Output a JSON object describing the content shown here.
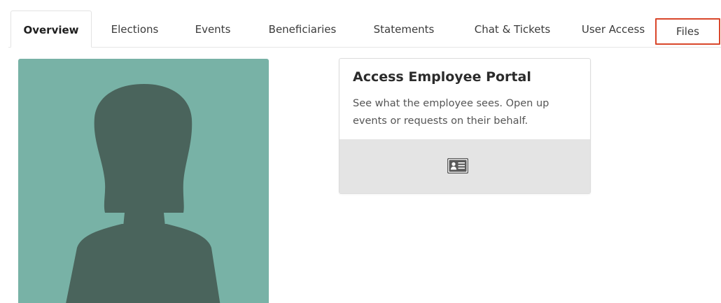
{
  "tabs": [
    {
      "label": "Overview",
      "active": true
    },
    {
      "label": "Elections"
    },
    {
      "label": "Events"
    },
    {
      "label": "Beneficiaries"
    },
    {
      "label": "Statements"
    },
    {
      "label": "Chat & Tickets"
    },
    {
      "label": "User Access"
    },
    {
      "label": "Files",
      "highlighted": true
    }
  ],
  "avatar": {
    "icon": "person-silhouette-icon",
    "background_color": "#78b2a6",
    "silhouette_color": "#4a645c"
  },
  "portal_card": {
    "title": "Access Employee Portal",
    "description": "See what the employee sees. Open up events or requests on their behalf.",
    "action_icon": "id-card-icon"
  },
  "colors": {
    "highlight_border": "#d9472b",
    "card_footer": "#e4e4e4"
  }
}
